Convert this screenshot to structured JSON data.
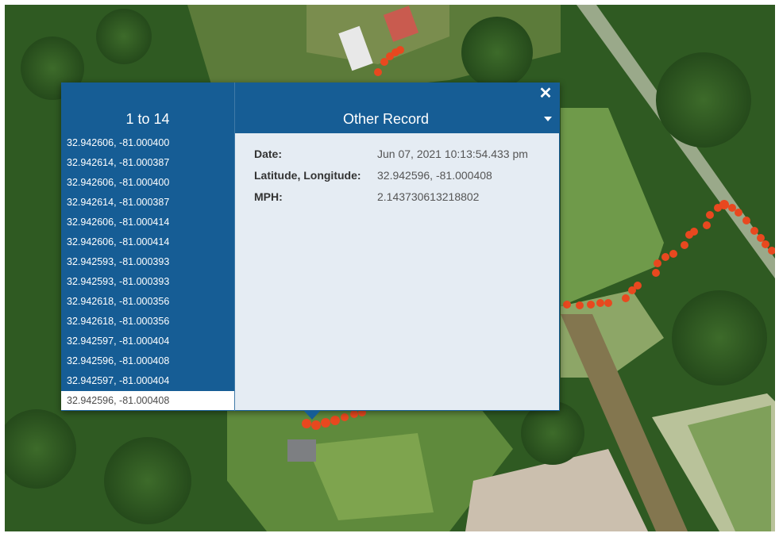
{
  "popup": {
    "list_header": "1 to 14",
    "detail_title": "Other Record",
    "close_icon": "close-icon",
    "dropdown_icon": "caret-down-icon",
    "accent_color": "#165d95",
    "records": [
      "32.942606, -81.000400",
      "32.942614, -81.000387",
      "32.942606, -81.000400",
      "32.942614, -81.000387",
      "32.942606, -81.000414",
      "32.942606, -81.000414",
      "32.942593, -81.000393",
      "32.942593, -81.000393",
      "32.942618, -81.000356",
      "32.942618, -81.000356",
      "32.942597, -81.000404",
      "32.942596, -81.000408",
      "32.942597, -81.000404",
      "32.942596, -81.000408"
    ],
    "selected_record_index": 13,
    "fields": [
      {
        "label": "Date:",
        "value": "Jun 07, 2021 10:13:54.433 pm"
      },
      {
        "label": "Latitude, Longitude:",
        "value": "32.942596, -81.000408"
      },
      {
        "label": "MPH:",
        "value": "2.143730613218802"
      }
    ]
  },
  "map": {
    "basemap": "satellite imagery",
    "track_color": "#e8481f"
  }
}
